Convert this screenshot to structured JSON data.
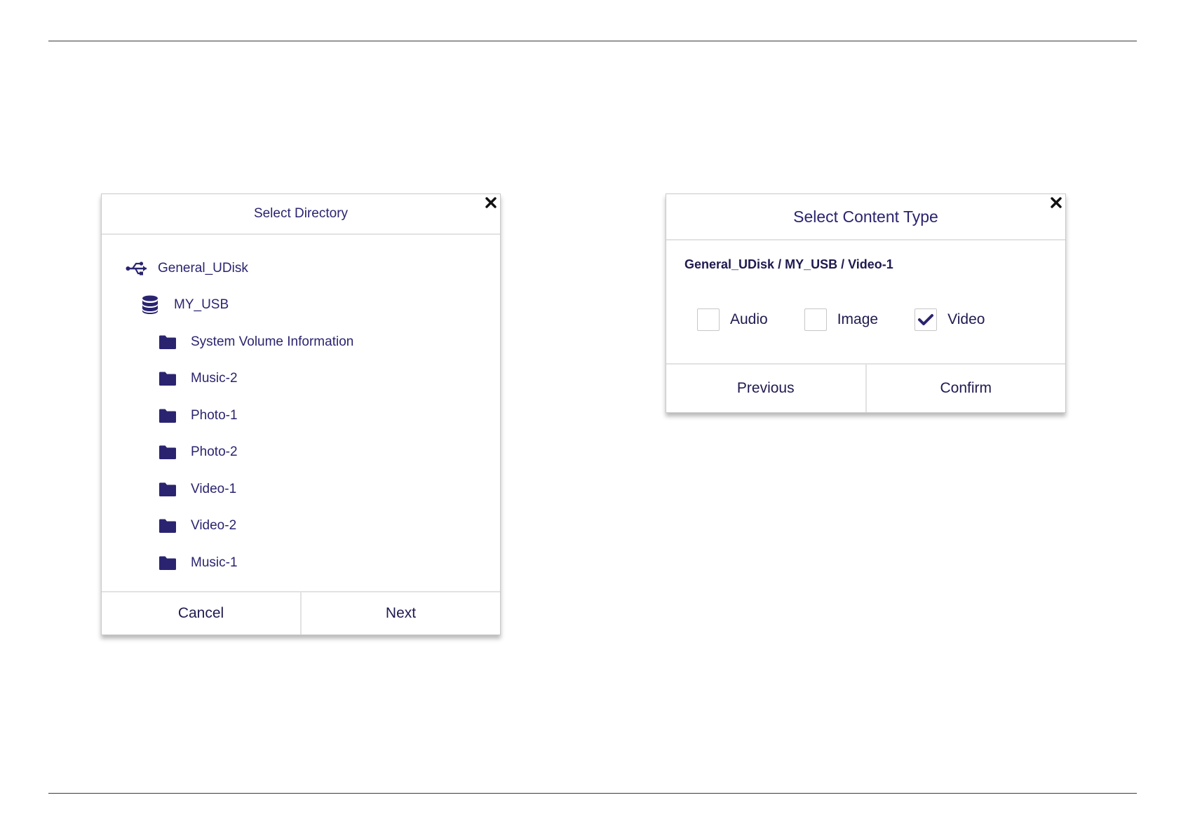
{
  "colors": {
    "accent": "#2a2470",
    "border": "#e2e2e2"
  },
  "select_directory": {
    "title": "Select Directory",
    "close_icon": "close-icon",
    "tree": [
      {
        "label": "General_UDisk",
        "icon": "usb-icon",
        "level": 0
      },
      {
        "label": "MY_USB",
        "icon": "database-icon",
        "level": 1
      },
      {
        "label": "System Volume Information",
        "icon": "folder-icon",
        "level": 2
      },
      {
        "label": "Music-2",
        "icon": "folder-icon",
        "level": 2
      },
      {
        "label": "Photo-1",
        "icon": "folder-icon",
        "level": 2
      },
      {
        "label": "Photo-2",
        "icon": "folder-icon",
        "level": 2
      },
      {
        "label": "Video-1",
        "icon": "folder-icon",
        "level": 2
      },
      {
        "label": "Video-2",
        "icon": "folder-icon",
        "level": 2
      },
      {
        "label": "Music-1",
        "icon": "folder-icon",
        "level": 2
      }
    ],
    "cancel_label": "Cancel",
    "next_label": "Next"
  },
  "select_content_type": {
    "title": "Select Content Type",
    "close_icon": "close-icon",
    "path": "General_UDisk / MY_USB / Video-1",
    "options": [
      {
        "label": "Audio",
        "checked": false
      },
      {
        "label": "Image",
        "checked": false
      },
      {
        "label": "Video",
        "checked": true
      }
    ],
    "previous_label": "Previous",
    "confirm_label": "Confirm"
  }
}
